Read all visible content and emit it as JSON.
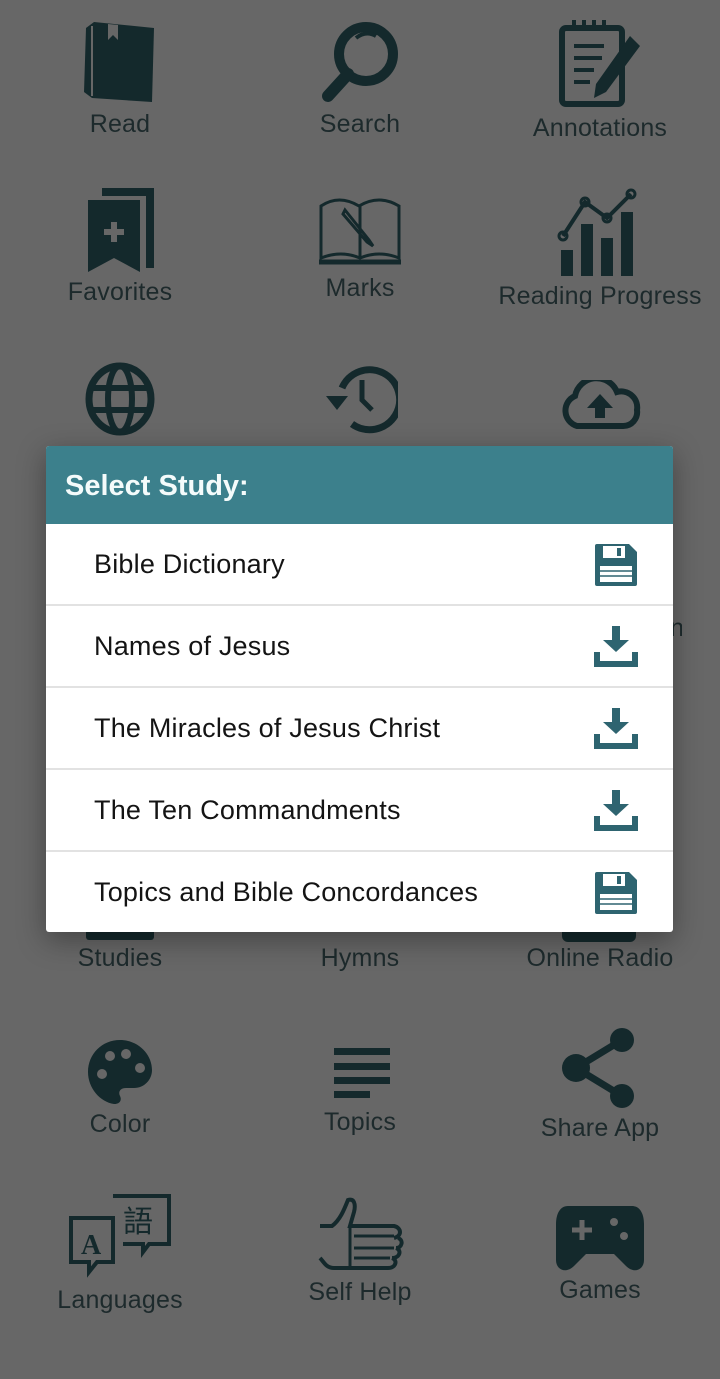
{
  "menu_grid": {
    "items": [
      {
        "label": "Read",
        "icon": "book-icon"
      },
      {
        "label": "Search",
        "icon": "magnifier-icon"
      },
      {
        "label": "Annotations",
        "icon": "notepad-pencil-icon"
      },
      {
        "label": "Favorites",
        "icon": "bookmark-plus-icon"
      },
      {
        "label": "Marks",
        "icon": "open-book-pencil-icon"
      },
      {
        "label": "Reading Progress",
        "icon": "chart-progress-icon"
      },
      {
        "label": "",
        "icon": "globe-icon"
      },
      {
        "label": "",
        "icon": "history-icon"
      },
      {
        "label": "",
        "icon": "cloud-upload-icon"
      },
      {
        "label": "Studies",
        "icon": "studies-icon"
      },
      {
        "label": "Hymns",
        "icon": "hymns-icon"
      },
      {
        "label": "Online Radio",
        "icon": "radio-icon"
      },
      {
        "label": "Color",
        "icon": "palette-icon"
      },
      {
        "label": "Topics",
        "icon": "lines-icon"
      },
      {
        "label": "Share App",
        "icon": "share-icon"
      },
      {
        "label": "Languages",
        "icon": "translate-icon"
      },
      {
        "label": "Self Help",
        "icon": "thumbs-up-icon"
      },
      {
        "label": "Games",
        "icon": "gamepad-icon"
      }
    ]
  },
  "dialog": {
    "title": "Select Study:",
    "items": [
      {
        "label": "Bible Dictionary",
        "status_icon": "save-icon",
        "status": "downloaded"
      },
      {
        "label": "Names of Jesus",
        "status_icon": "download-icon",
        "status": "available"
      },
      {
        "label": "The Miracles of Jesus Christ",
        "status_icon": "download-icon",
        "status": "available"
      },
      {
        "label": "The Ten Commandments",
        "status_icon": "download-icon",
        "status": "available"
      },
      {
        "label": "Topics and Bible Concordances",
        "status_icon": "save-icon",
        "status": "downloaded"
      }
    ]
  },
  "colors": {
    "overlay_background": "#676767",
    "icon_dark": "#14292c",
    "dialog_header": "#3c808c",
    "dialog_icon": "#2e6470",
    "divider": "#e2e2e2"
  }
}
